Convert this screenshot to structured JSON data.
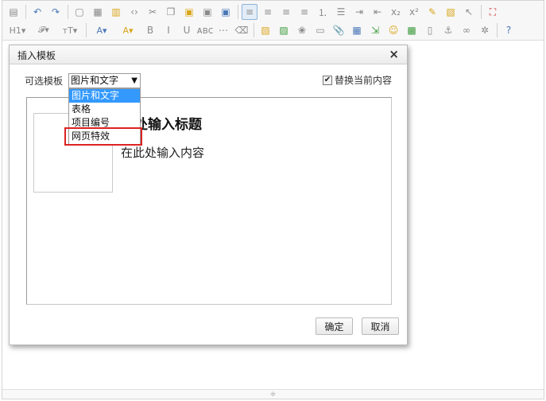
{
  "toolbar": {
    "row1": [
      {
        "name": "source-icon",
        "glyph": "▤",
        "color": "ic-gray"
      },
      {
        "sep": true
      },
      {
        "name": "undo-icon",
        "glyph": "↶",
        "color": "ic-blue"
      },
      {
        "name": "redo-icon",
        "glyph": "↷",
        "color": "ic-blue"
      },
      {
        "sep": true
      },
      {
        "name": "preview-icon",
        "glyph": "▢",
        "color": "ic-gray"
      },
      {
        "name": "print-icon",
        "glyph": "▦",
        "color": "ic-gray"
      },
      {
        "name": "template-icon",
        "glyph": "▥",
        "color": "ic-yellow"
      },
      {
        "name": "code-icon",
        "glyph": "‹›",
        "color": "ic-gray"
      },
      {
        "name": "cut-icon",
        "glyph": "✂",
        "color": "ic-gray"
      },
      {
        "name": "copy-icon",
        "glyph": "❐",
        "color": "ic-gray"
      },
      {
        "name": "paste-icon",
        "glyph": "▣",
        "color": "ic-yellow"
      },
      {
        "name": "paste-text-icon",
        "glyph": "▣",
        "color": "ic-gray"
      },
      {
        "name": "paste-word-icon",
        "glyph": "▣",
        "color": "ic-blue"
      },
      {
        "sep": true
      },
      {
        "name": "align-left-icon",
        "glyph": "≡",
        "color": "ic-gray",
        "active": true
      },
      {
        "name": "align-center-icon",
        "glyph": "≡",
        "color": "ic-gray"
      },
      {
        "name": "align-right-icon",
        "glyph": "≡",
        "color": "ic-gray"
      },
      {
        "name": "align-justify-icon",
        "glyph": "≡",
        "color": "ic-gray"
      },
      {
        "name": "ordered-list-icon",
        "glyph": "⒈",
        "color": "ic-gray"
      },
      {
        "name": "unordered-list-icon",
        "glyph": "☰",
        "color": "ic-gray"
      },
      {
        "name": "indent-icon",
        "glyph": "⇥",
        "color": "ic-gray"
      },
      {
        "name": "outdent-icon",
        "glyph": "⇤",
        "color": "ic-gray"
      },
      {
        "name": "subscript-icon",
        "glyph": "x₂",
        "color": "ic-gray"
      },
      {
        "name": "superscript-icon",
        "glyph": "x²",
        "color": "ic-gray"
      },
      {
        "name": "clear-format-icon",
        "glyph": "✎",
        "color": "ic-yellow"
      },
      {
        "name": "select-all-icon",
        "glyph": "▧",
        "color": "ic-yellow"
      },
      {
        "name": "pointer-icon",
        "glyph": "↖",
        "color": "ic-gray"
      },
      {
        "sep": true
      },
      {
        "name": "fullscreen-icon",
        "glyph": "⛶",
        "color": "ic-red"
      }
    ],
    "row2": [
      {
        "name": "heading-icon",
        "glyph": "H1▾",
        "color": "ic-gray",
        "wide": true
      },
      {
        "name": "font-family-icon",
        "glyph": "𝓕▾",
        "color": "ic-gray",
        "wide": true
      },
      {
        "name": "font-size-icon",
        "glyph": "тT▾",
        "color": "ic-gray",
        "wide": true
      },
      {
        "sep": true
      },
      {
        "name": "font-color-icon",
        "glyph": "A▾",
        "color": "ic-blue",
        "wide": true
      },
      {
        "name": "highlight-color-icon",
        "glyph": "A▾",
        "color": "ic-yellow",
        "wide": true
      },
      {
        "name": "bold-icon",
        "glyph": "B",
        "color": "ic-gray"
      },
      {
        "name": "italic-icon",
        "glyph": "I",
        "color": "ic-gray"
      },
      {
        "name": "underline-icon",
        "glyph": "U",
        "color": "ic-gray"
      },
      {
        "name": "strikethrough-icon",
        "glyph": "ᴀʙᴄ",
        "color": "ic-gray"
      },
      {
        "name": "hr-icon",
        "glyph": "⋯",
        "color": "ic-gray"
      },
      {
        "name": "eraser-icon",
        "glyph": "⌫",
        "color": "ic-gray"
      },
      {
        "sep": true
      },
      {
        "name": "image-icon",
        "glyph": "▨",
        "color": "ic-yellow"
      },
      {
        "name": "multi-image-icon",
        "glyph": "▨",
        "color": "ic-green"
      },
      {
        "name": "flash-icon",
        "glyph": "❀",
        "color": "ic-gray"
      },
      {
        "name": "video-icon",
        "glyph": "▭",
        "color": "ic-gray"
      },
      {
        "name": "attachment-icon",
        "glyph": "📎",
        "color": "ic-gray"
      },
      {
        "name": "table-icon",
        "glyph": "▦",
        "color": "ic-blue"
      },
      {
        "name": "insert-row-icon",
        "glyph": "⇲",
        "color": "ic-green"
      },
      {
        "name": "emoticon-icon",
        "glyph": "☺",
        "color": "ic-yellow"
      },
      {
        "name": "map-icon",
        "glyph": "▩",
        "color": "ic-green"
      },
      {
        "name": "page-break-icon",
        "glyph": "▯",
        "color": "ic-gray"
      },
      {
        "name": "anchor-icon",
        "glyph": "⚓",
        "color": "ic-gray"
      },
      {
        "name": "link-icon",
        "glyph": "∞",
        "color": "ic-gray"
      },
      {
        "name": "unlink-icon",
        "glyph": "✲",
        "color": "ic-gray"
      },
      {
        "sep": true
      },
      {
        "name": "help-icon",
        "glyph": "?",
        "color": "ic-blue"
      }
    ]
  },
  "dialog": {
    "title": "插入模板",
    "close_glyph": "×",
    "template_label": "可选模板",
    "selected_template": "图片和文字",
    "template_options": [
      "图片和文字",
      "表格",
      "项目编号",
      "网页特效"
    ],
    "replace_label": "替换当前内容",
    "replace_checked": true,
    "check_glyph": "✔",
    "preview_title": "此处输入标题",
    "preview_body": "在此处输入内容",
    "ok_label": "确定",
    "cancel_label": "取消"
  },
  "resize_glyph": "≑",
  "highlight_color": "#dd2222"
}
